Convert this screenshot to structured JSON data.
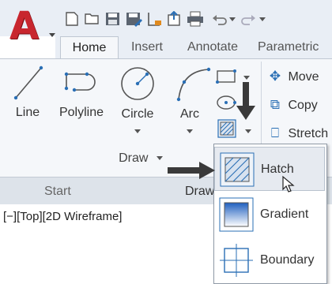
{
  "ribbon_tabs": [
    "Home",
    "Insert",
    "Annotate",
    "Parametric"
  ],
  "draw_tools": {
    "line": "Line",
    "polyline": "Polyline",
    "circle": "Circle",
    "arc": "Arc"
  },
  "draw_panel_title": "Draw",
  "modify_panel": [
    "Move",
    "Copy",
    "Stretch"
  ],
  "file_tabs": [
    "Start",
    "Draw"
  ],
  "viewport_label": "[−][Top][2D Wireframe]",
  "hatch_flyout": [
    "Hatch",
    "Gradient",
    "Boundary"
  ],
  "icons": {
    "app_menu": "autocad-logo-icon",
    "qat": [
      "new-icon",
      "open-icon",
      "save-icon",
      "save-as-icon",
      "plot-icon",
      "export-icon",
      "print-icon",
      "undo-icon",
      "redo-icon"
    ]
  },
  "colors": {
    "brand_red": "#c8262e",
    "icon_blue": "#2a6fb5",
    "ribbon_bg": "#f5f7fa"
  }
}
